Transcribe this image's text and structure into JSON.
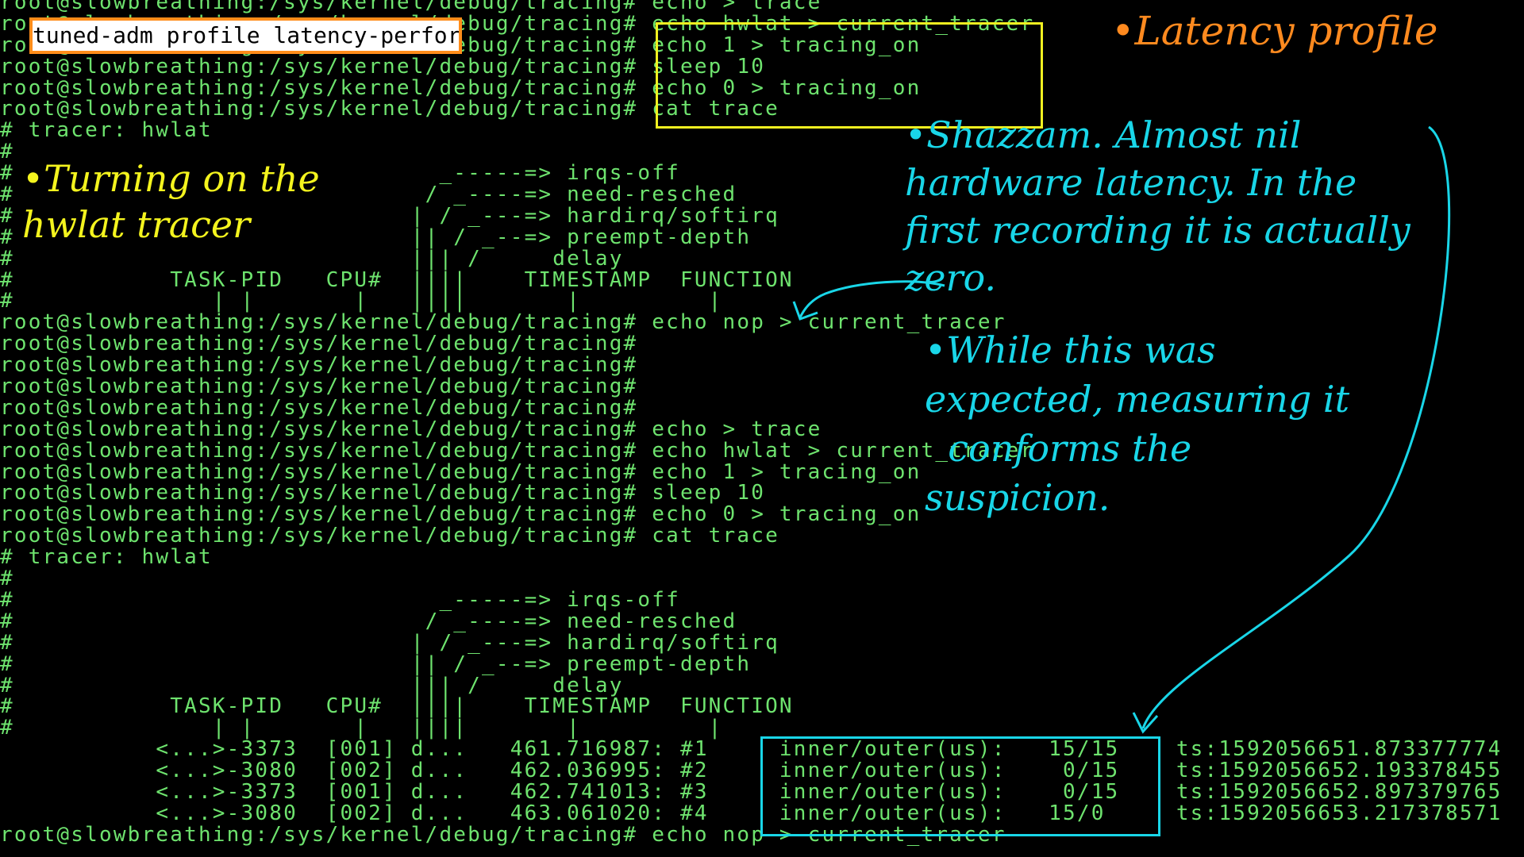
{
  "terminal": {
    "lines": [
      "root@slowbreathing:/sys/kernel/debug/tracing# echo > trace",
      "root@slowbreathing:/sys/kernel/debug/tracing# echo hwlat > current_tracer",
      "root@slowbreathing:/sys/kernel/debug/tracing# echo 1 > tracing_on",
      "root@slowbreathing:/sys/kernel/debug/tracing# sleep 10",
      "root@slowbreathing:/sys/kernel/debug/tracing# echo 0 > tracing_on",
      "root@slowbreathing:/sys/kernel/debug/tracing# cat trace",
      "# tracer: hwlat",
      "#",
      "#                              _-----=> irqs-off",
      "#                             / _----=> need-resched",
      "#                            | / _---=> hardirq/softirq",
      "#                            || / _--=> preempt-depth",
      "#                            ||| /     delay",
      "#           TASK-PID   CPU#  ||||    TIMESTAMP  FUNCTION",
      "#              | |       |   ||||       |         |",
      "root@slowbreathing:/sys/kernel/debug/tracing# echo nop > current_tracer",
      "root@slowbreathing:/sys/kernel/debug/tracing#",
      "root@slowbreathing:/sys/kernel/debug/tracing#",
      "root@slowbreathing:/sys/kernel/debug/tracing#",
      "root@slowbreathing:/sys/kernel/debug/tracing#",
      "root@slowbreathing:/sys/kernel/debug/tracing# echo > trace",
      "root@slowbreathing:/sys/kernel/debug/tracing# echo hwlat > current_tracer",
      "root@slowbreathing:/sys/kernel/debug/tracing# echo 1 > tracing_on",
      "root@slowbreathing:/sys/kernel/debug/tracing# sleep 10",
      "root@slowbreathing:/sys/kernel/debug/tracing# echo 0 > tracing_on",
      "root@slowbreathing:/sys/kernel/debug/tracing# cat trace",
      "# tracer: hwlat",
      "#",
      "#                              _-----=> irqs-off",
      "#                             / _----=> need-resched",
      "#                            | / _---=> hardirq/softirq",
      "#                            || / _--=> preempt-depth",
      "#                            ||| /     delay",
      "#           TASK-PID   CPU#  ||||    TIMESTAMP  FUNCTION",
      "#              | |       |   ||||       |         |",
      "           <...>-3373  [001] d...   461.716987: #1     inner/outer(us):   15/15    ts:1592056651.873377774",
      "           <...>-3080  [002] d...   462.036995: #2     inner/outer(us):    0/15    ts:1592056652.193378455",
      "           <...>-3373  [001] d...   462.741013: #3     inner/outer(us):    0/15    ts:1592056652.897379765",
      "           <...>-3080  [002] d...   463.061020: #4     inner/outer(us):   15/0     ts:1592056653.217378571",
      "root@slowbreathing:/sys/kernel/debug/tracing# echo nop > current_tracer"
    ]
  },
  "overlay_tag": "tuned-adm profile latency-performance",
  "annotations": {
    "latency_profile": "•Latency profile",
    "hwlat_note": "•Turning on the\nhwlat tracer",
    "shazzam_note": "•Shazzam. Almost nil\nhardware latency. In the\nfirst recording it is actually\nzero.",
    "expected_note": "•While this was\nexpected, measuring it\n  conforms the\nsuspicion."
  },
  "colors": {
    "terminal_text": "#6ee36e",
    "background": "#000000",
    "orange": "#ff8a1f",
    "yellow": "#f4f41e",
    "cyan": "#19d6e8"
  }
}
